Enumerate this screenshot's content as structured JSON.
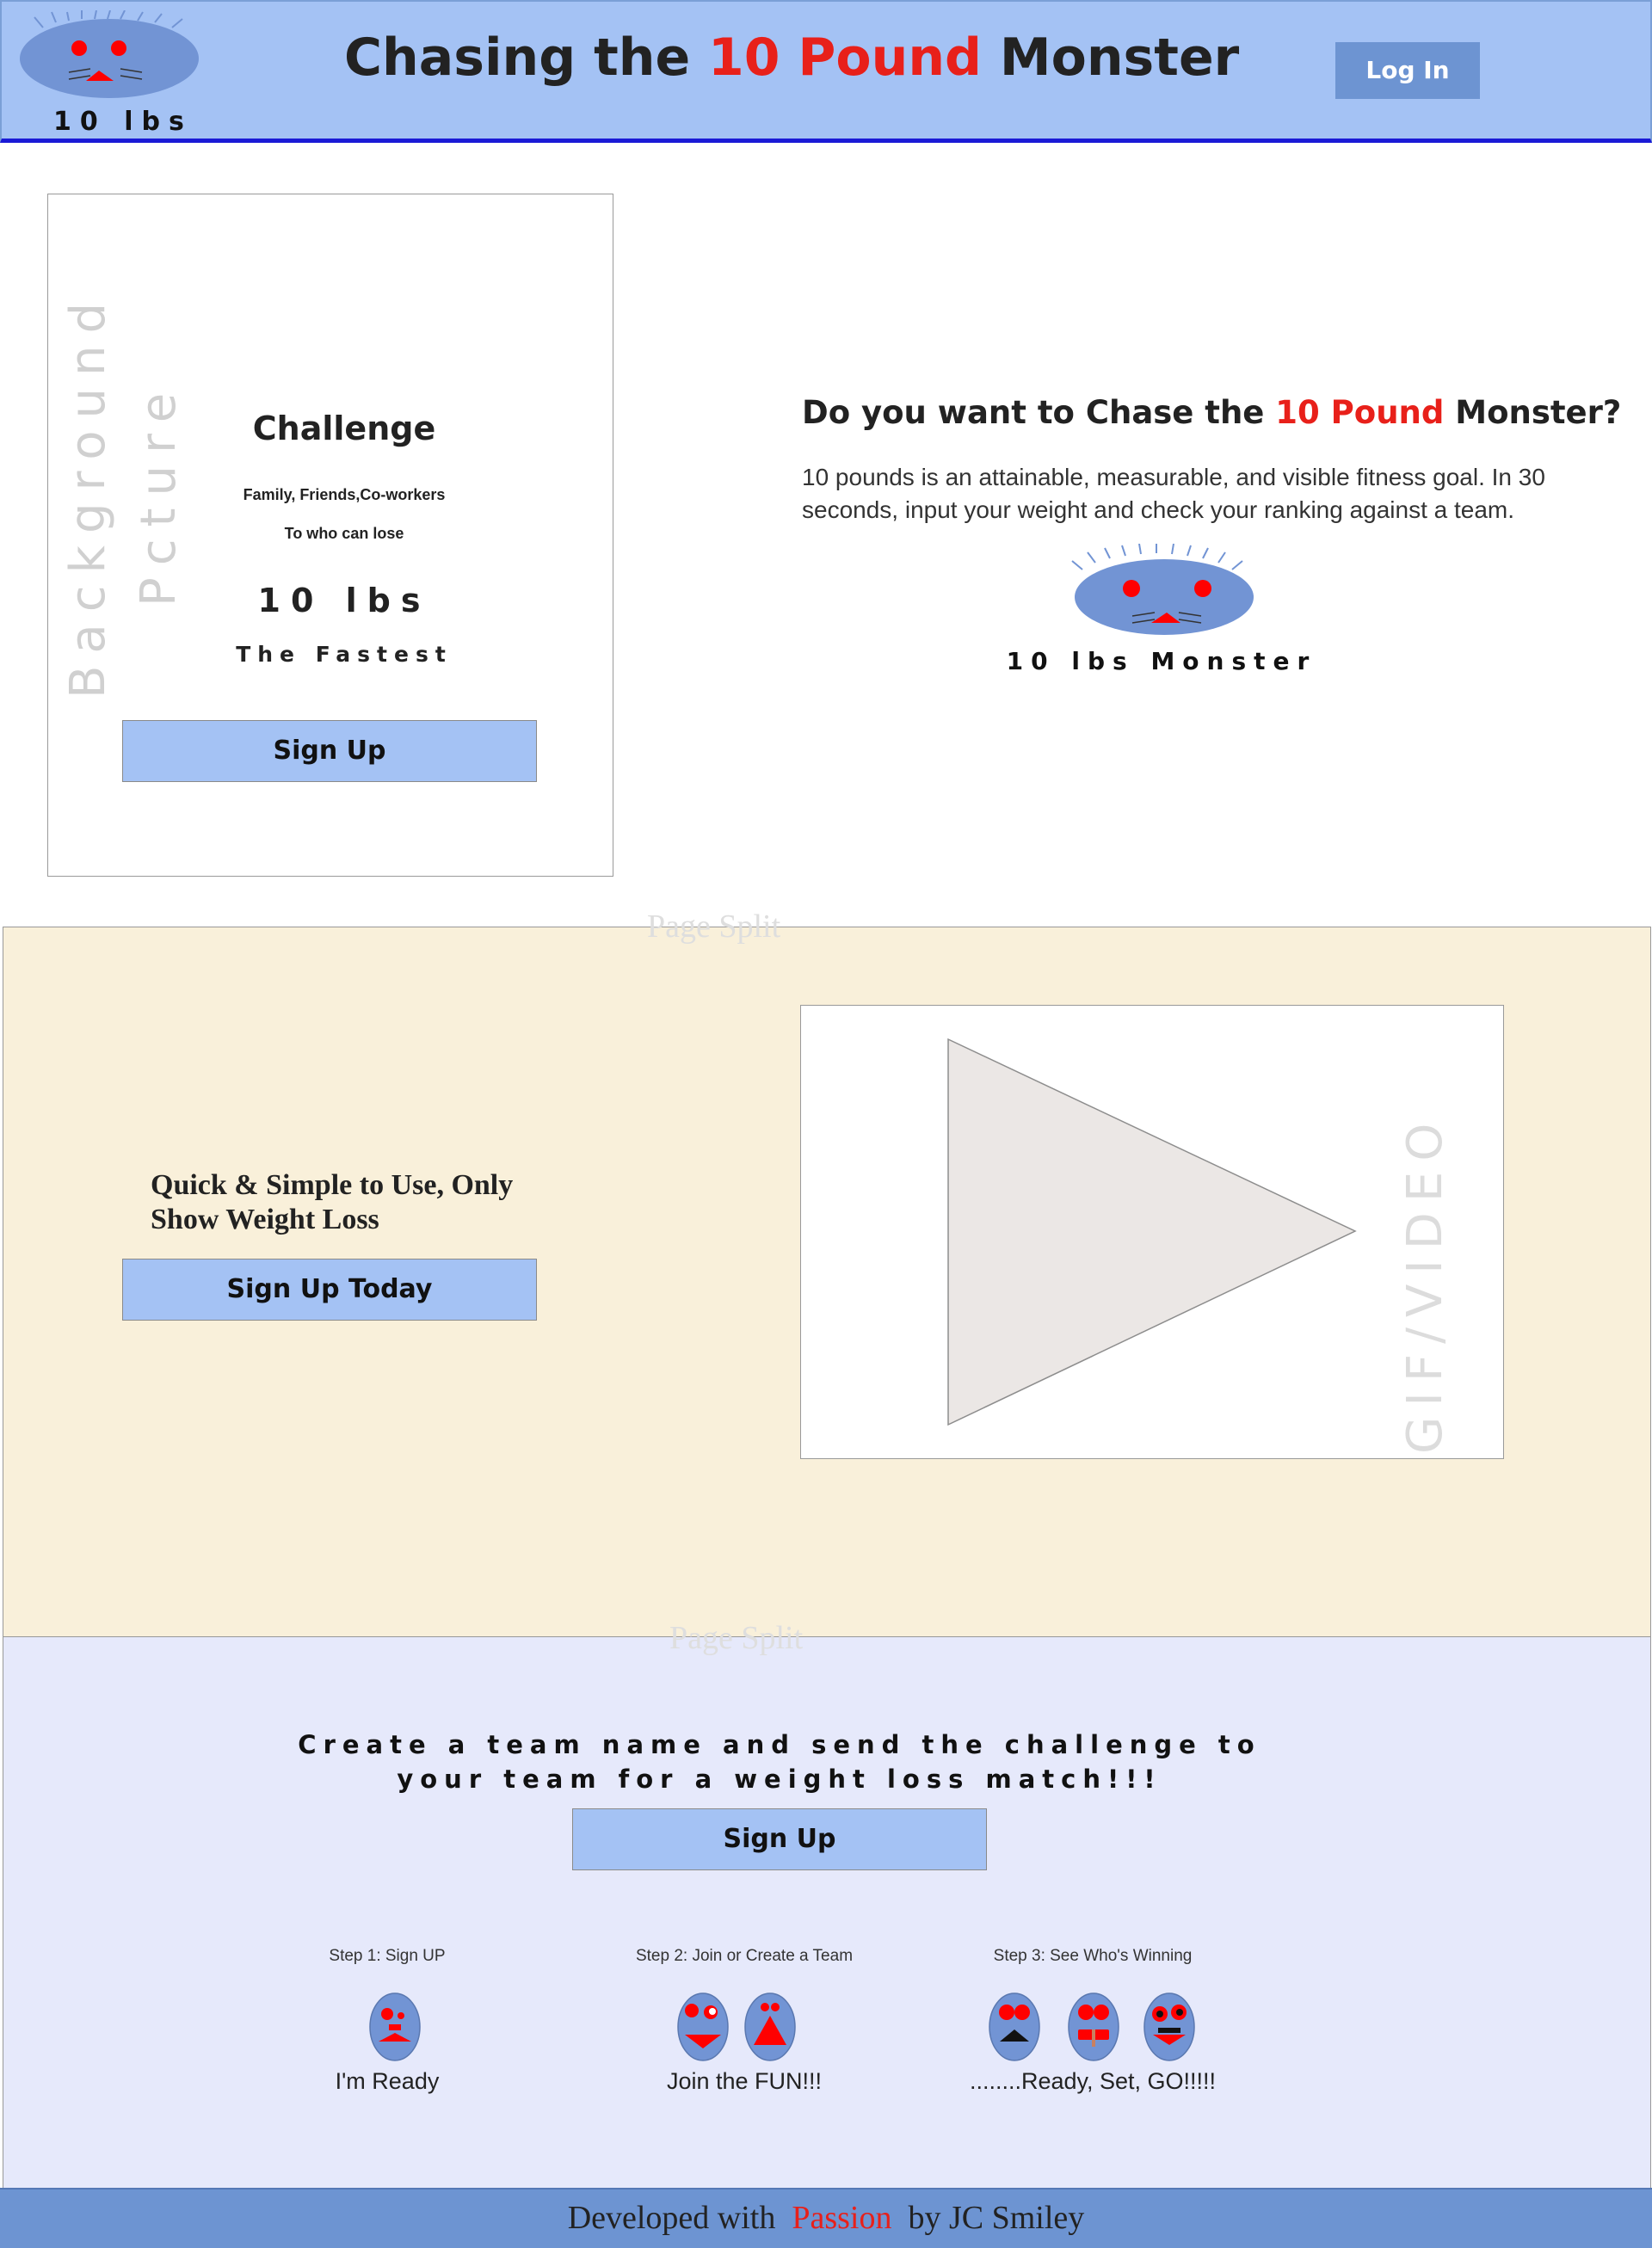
{
  "header": {
    "logo_text": "10 lbs",
    "title_part1": "Chasing the ",
    "title_accent": "10 Pound",
    "title_part2": " Monster",
    "login_label": "Log In"
  },
  "hero": {
    "card": {
      "bg_word1": "Background",
      "bg_word2": "Pcture",
      "title": "Challenge",
      "line1": "Family, Friends,Co-workers",
      "line2": "To who can lose",
      "big": "10 lbs",
      "fastest": "The Fastest",
      "signup_label": "Sign Up"
    },
    "question_part1": "Do you want to Chase the ",
    "question_accent": "10 Pound",
    "question_part2": " Monster?",
    "description": "10 pounds is an attainable, measurable, and visible fitness goal. In 30 seconds, input your weight and check your ranking against a team.",
    "monster_label": "10 lbs Monster"
  },
  "splits": [
    "Page Split",
    "Page Split"
  ],
  "section2": {
    "heading": "Quick & Simple to Use, Only Show Weight Loss",
    "signup_label": "Sign Up Today",
    "video_label": "GIF/VIDEO"
  },
  "section3": {
    "heading": "Create a team name and send the challenge to your team for a weight loss match!!!",
    "signup_label": "Sign Up",
    "steps": [
      {
        "title": "Step 1: Sign UP",
        "caption": "I'm Ready"
      },
      {
        "title": "Step 2: Join or Create a Team",
        "caption": "Join the FUN!!!"
      },
      {
        "title": "Step 3: See Who's Winning",
        "caption": "........Ready, Set, GO!!!!!"
      }
    ]
  },
  "footer": {
    "part1": "Developed with  ",
    "accent": "Passion",
    "part2": "  by JC Smiley"
  },
  "colors": {
    "header_bg": "#a4c2f4",
    "accent_red": "#e8201a",
    "button_blue": "#a4c2f4",
    "login_blue": "#6d94d2",
    "section2_bg": "#f9f0da",
    "section3_bg": "#e6e9fb",
    "monster_blue": "#7294d4"
  },
  "icons": [
    "monster-logo-icon",
    "play-icon",
    "monster-face-icon"
  ]
}
